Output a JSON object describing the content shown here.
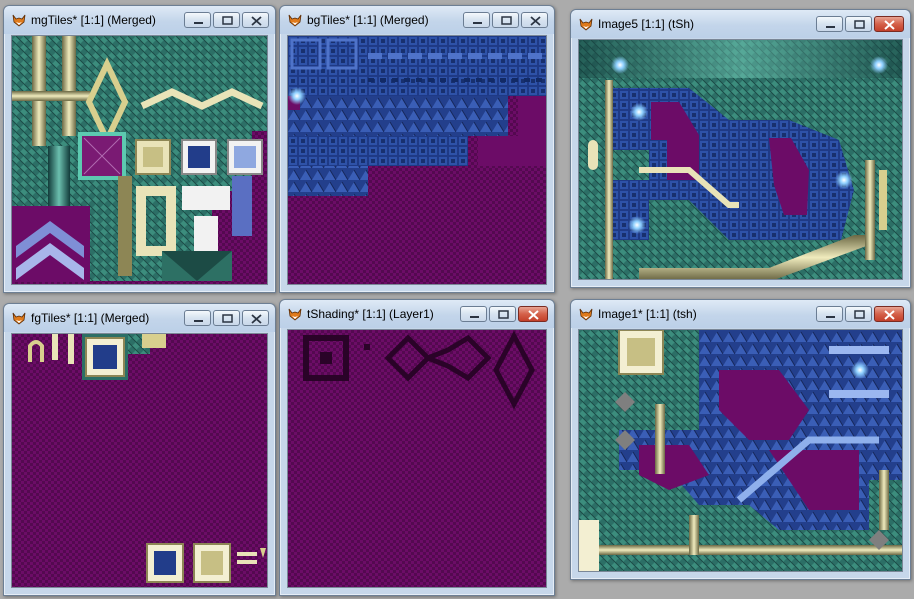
{
  "windows": {
    "mg": {
      "title": "mgTiles* [1:1] (Merged)"
    },
    "bg": {
      "title": "bgTiles* [1:1] (Merged)"
    },
    "img5": {
      "title": "Image5 [1:1] (tSh)"
    },
    "fg": {
      "title": "fgTiles* [1:1] (Merged)"
    },
    "shade": {
      "title": "tShading* [1:1] (Layer1)"
    },
    "img1": {
      "title": "Image1* [1:1] (tsh)"
    }
  },
  "icons": {
    "app": "fox-app-icon",
    "minimize": "minimize-icon",
    "maximize": "maximize-icon",
    "close": "close-icon"
  },
  "colors": {
    "desktop": "#ababab",
    "transparent_bg": "#6c0c67",
    "teal_tile": "#2f7a6c",
    "blue_tile": "#243e8a",
    "gold_pipe": "#d8cf8e",
    "close_button": "#c94a35"
  }
}
